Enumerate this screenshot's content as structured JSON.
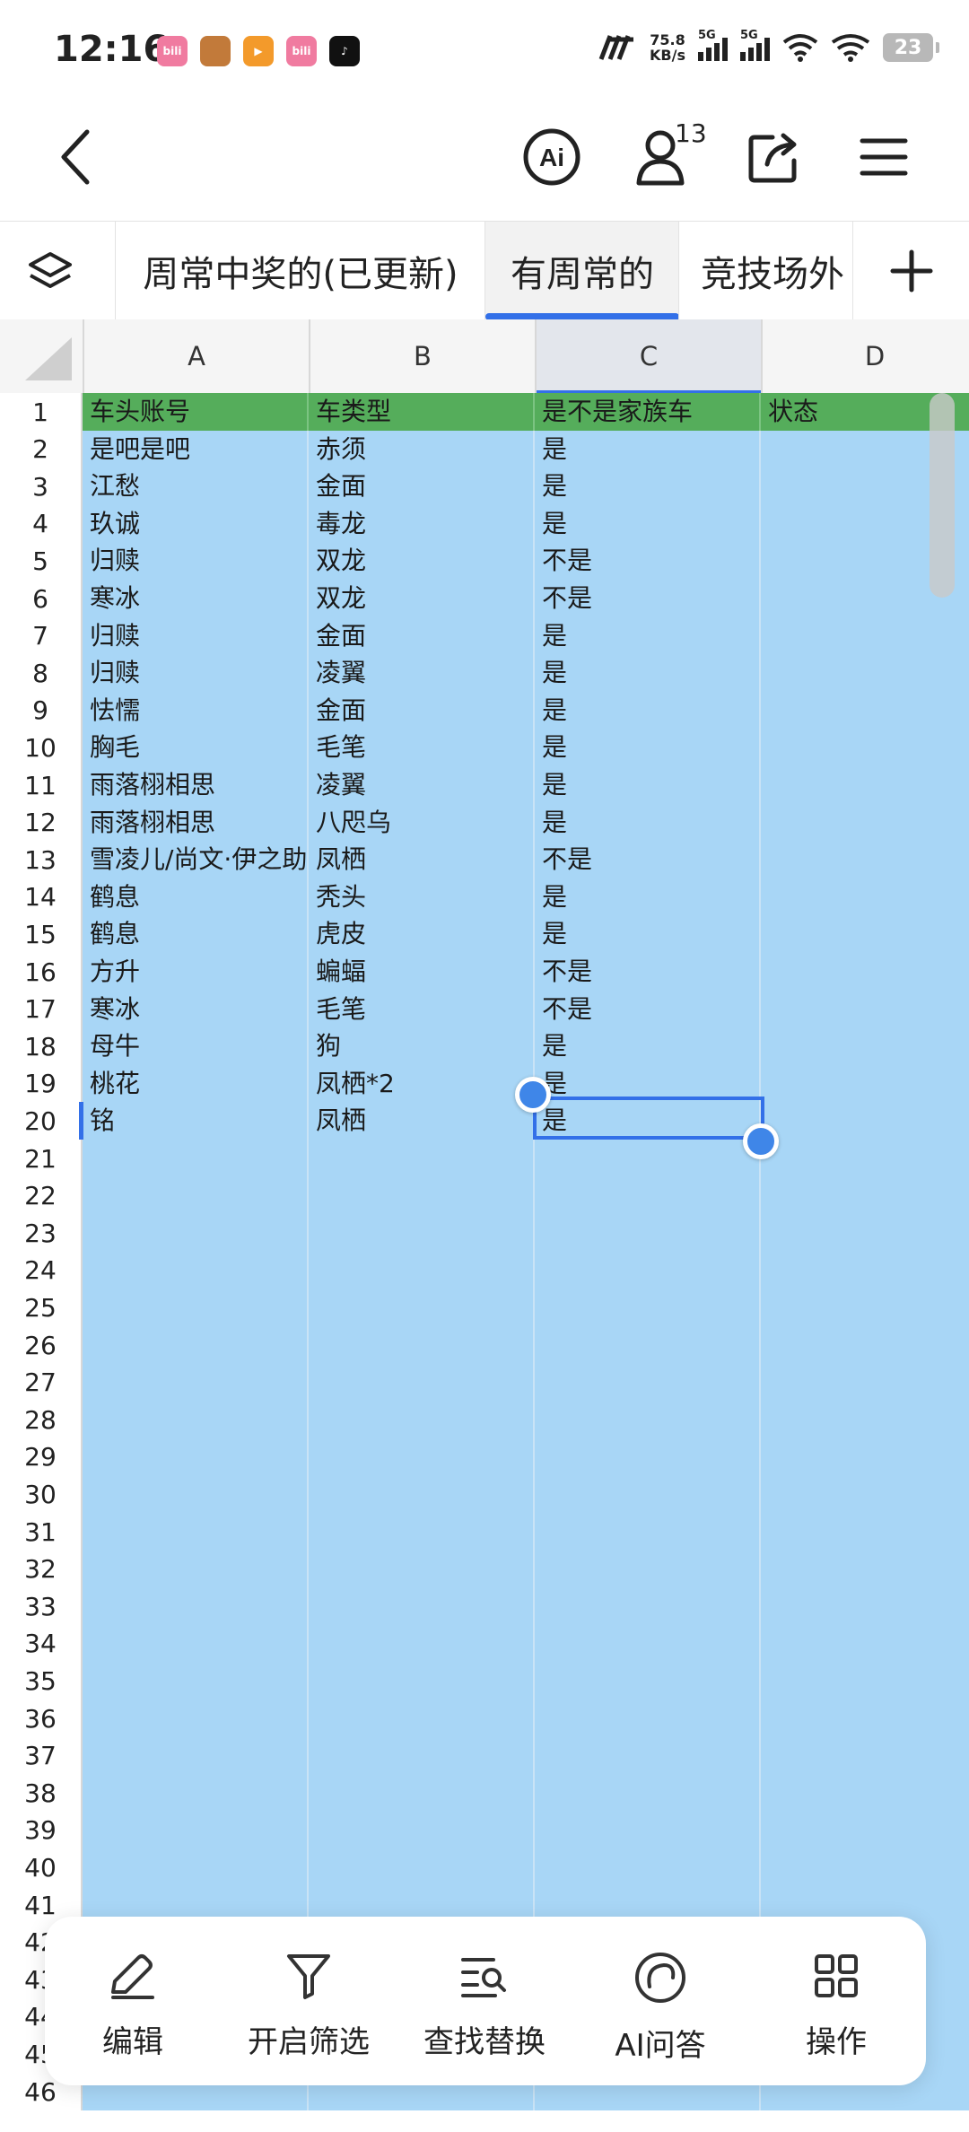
{
  "status": {
    "time": "12:16",
    "apps": [
      {
        "name": "bilibili-icon",
        "label": "bili",
        "color": "#f07ba0"
      },
      {
        "name": "game-icon",
        "label": "",
        "color": "#c27a3a"
      },
      {
        "name": "video-app-icon",
        "label": "▶",
        "color": "#f39a2b"
      },
      {
        "name": "bilibili-icon-2",
        "label": "bili",
        "color": "#f07ba0"
      },
      {
        "name": "tiktok-icon",
        "label": "♪",
        "color": "#111111"
      }
    ],
    "speed_value": "75.8",
    "speed_unit": "KB/s",
    "net1": "5G",
    "net2": "5G",
    "battery": "23"
  },
  "header": {
    "collaborators_count": "13"
  },
  "tabs": [
    {
      "label": "周常中奖的(已更新)",
      "active": false
    },
    {
      "label": "有周常的",
      "active": true
    },
    {
      "label": "竞技场外",
      "active": false
    }
  ],
  "columns": [
    "A",
    "B",
    "C",
    "D"
  ],
  "selected_column": "C",
  "table": {
    "headers": [
      "车头账号",
      "车类型",
      "是不是家族车",
      "状态"
    ],
    "rows": [
      [
        "是吧是吧",
        "赤须",
        "是",
        ""
      ],
      [
        "江愁",
        "金面",
        "是",
        ""
      ],
      [
        "玖诚",
        "毒龙",
        "是",
        ""
      ],
      [
        "归赎",
        "双龙",
        "不是",
        ""
      ],
      [
        "寒冰",
        "双龙",
        "不是",
        ""
      ],
      [
        "归赎",
        "金面",
        "是",
        ""
      ],
      [
        "归赎",
        "凌翼",
        "是",
        ""
      ],
      [
        "怯懦",
        "金面",
        "是",
        ""
      ],
      [
        "胸毛",
        "毛笔",
        "是",
        ""
      ],
      [
        "雨落栩相思",
        "凌翼",
        "是",
        ""
      ],
      [
        "雨落栩相思",
        "八咫乌",
        "是",
        ""
      ],
      [
        "雪凌儿/尚文·伊之助",
        "凤栖",
        "不是",
        ""
      ],
      [
        "鹤息",
        "秃头",
        "是",
        ""
      ],
      [
        "鹤息",
        "虎皮",
        "是",
        ""
      ],
      [
        "方升",
        "蝙蝠",
        "不是",
        ""
      ],
      [
        "寒冰",
        "毛笔",
        "不是",
        ""
      ],
      [
        "母牛",
        "狗",
        "是",
        ""
      ],
      [
        "桃花",
        "凤栖*2",
        "是",
        ""
      ],
      [
        "铭",
        "凤栖",
        "是",
        ""
      ]
    ],
    "row_numbers": [
      "1",
      "2",
      "3",
      "4",
      "5",
      "6",
      "7",
      "8",
      "9",
      "10",
      "11",
      "12",
      "13",
      "14",
      "15",
      "16",
      "17",
      "18",
      "19",
      "20",
      "21",
      "22",
      "23",
      "24",
      "25",
      "26",
      "27",
      "28",
      "29",
      "30",
      "31",
      "32",
      "33",
      "34",
      "35",
      "36",
      "37",
      "38",
      "39",
      "40",
      "41",
      "42",
      "43",
      "44",
      "45",
      "46"
    ]
  },
  "toolbar": [
    {
      "label": "编辑",
      "icon": "pencil-icon"
    },
    {
      "label": "开启筛选",
      "icon": "filter-icon"
    },
    {
      "label": "查找替换",
      "icon": "find-replace-icon"
    },
    {
      "label": "AI问答",
      "icon": "ai-chat-icon"
    },
    {
      "label": "操作",
      "icon": "grid-operations-icon"
    }
  ],
  "colors": {
    "header_row": "#55ad5b",
    "cell_fill": "#a8d6f6",
    "accent": "#3370e8"
  }
}
